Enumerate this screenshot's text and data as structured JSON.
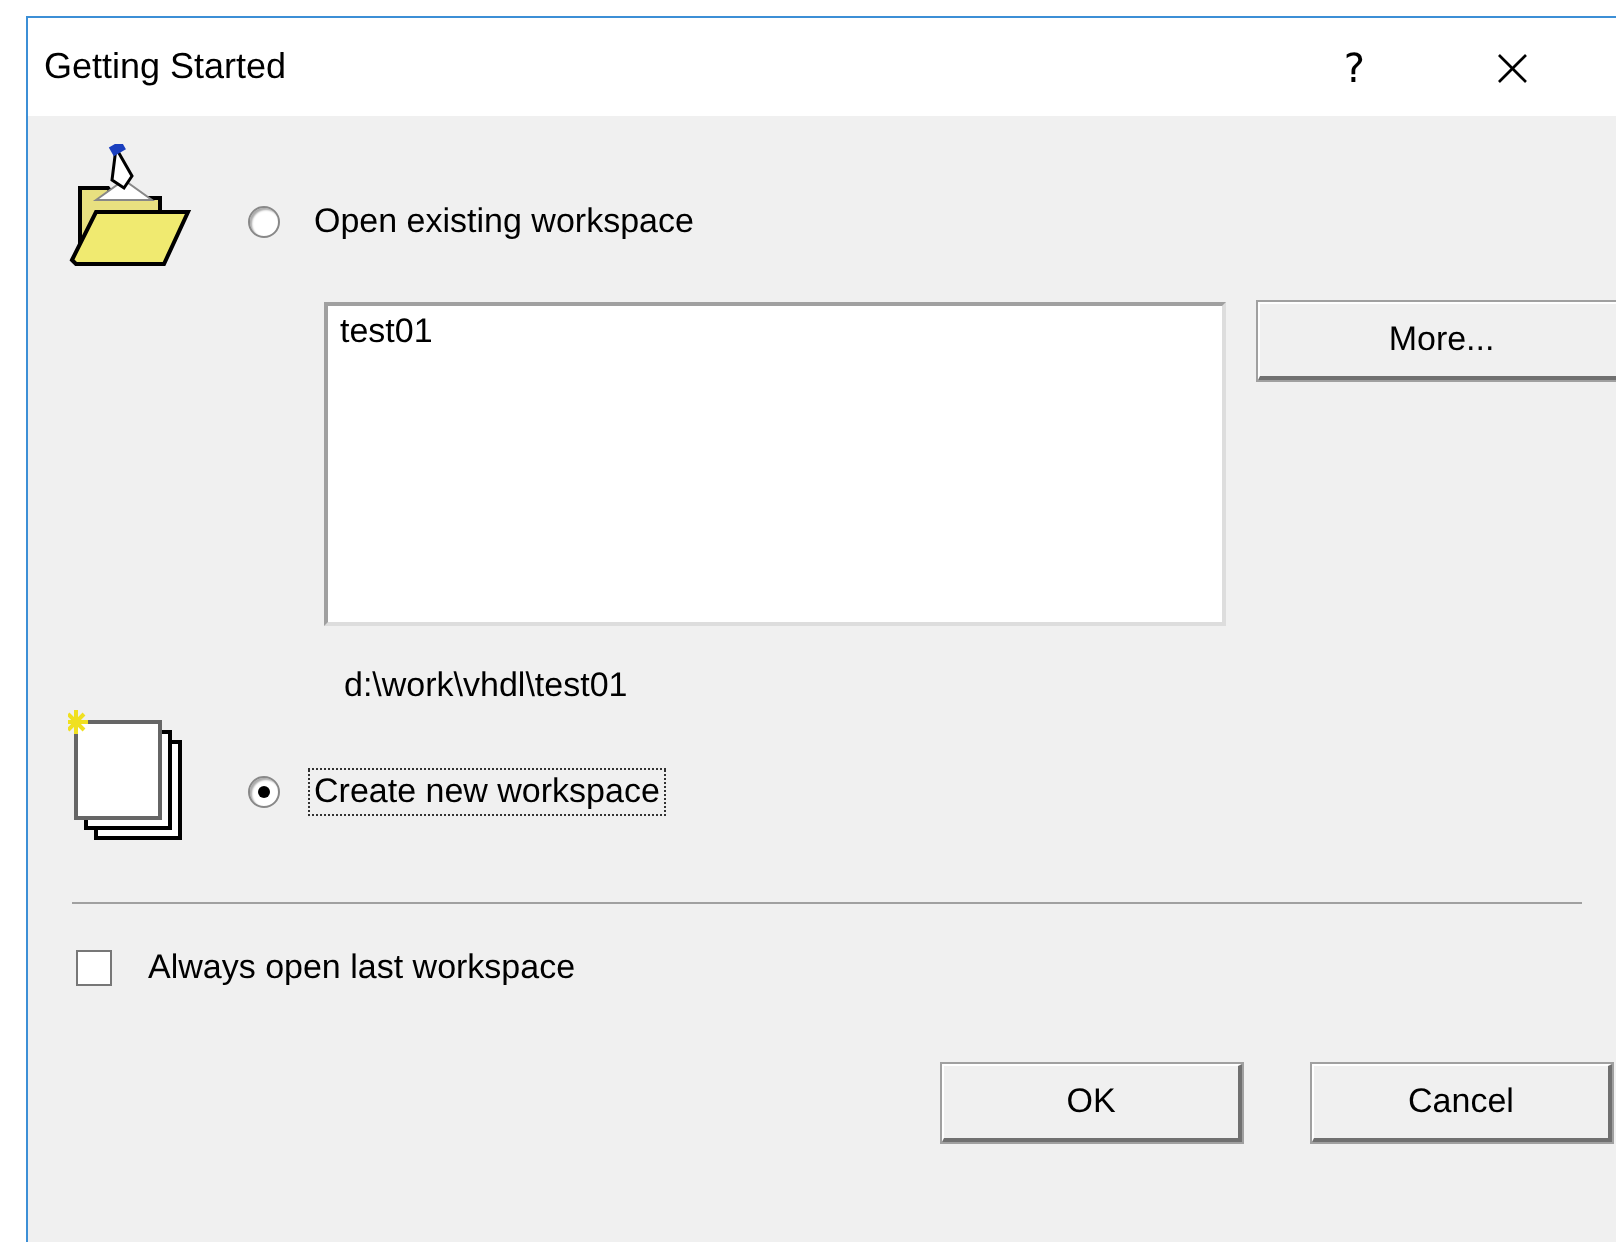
{
  "window": {
    "title": "Getting Started",
    "help": "?",
    "close": "×"
  },
  "options": [
    {
      "label": "Open existing workspace",
      "selected": false,
      "focused": false
    },
    {
      "label": "Create new workspace",
      "selected": true,
      "focused": true
    }
  ],
  "workspace_list": {
    "items": [
      {
        "label": "test01",
        "selected": false
      }
    ]
  },
  "more_button": "More...",
  "path": "d:\\work\\vhdl\\test01",
  "always_open_last": {
    "label": "Always open last workspace",
    "checked": false
  },
  "buttons": [
    "OK",
    "Cancel"
  ]
}
